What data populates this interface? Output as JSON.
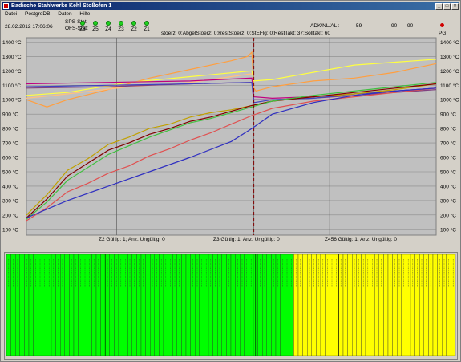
{
  "window": {
    "title": "Badische Stahlwerke Kehl Stoßofen 1"
  },
  "menu": [
    "Datei",
    "PostgreDB",
    "Daten",
    "Hilfe"
  ],
  "info": {
    "datetime": "28.02.2012 17:06:06",
    "sps_label": "SPS-Stat:",
    "ofs_label": "OFS-Stat:",
    "zones": [
      "Z6",
      "Z5",
      "Z4",
      "Z3",
      "Z2",
      "Z1"
    ],
    "status_text": "stoerz:   0;AbgelStoerz:   0;RestStoerz:   0;StEFlg: 0;RestTakt:   37;Solltakt: 60",
    "adk_label": "ADK/NL/AL  :",
    "adk_value": "59",
    "val_a": "90",
    "val_b": "90",
    "pg_label": "PG",
    "led_color": "#1fd11f",
    "pg_color": "#d00000"
  },
  "chart_data": {
    "type": "line",
    "title": "",
    "xlabel": "",
    "ylabel": "",
    "ylim": [
      60,
      1430
    ],
    "yticks": [
      "1400 °C",
      "1300 °C",
      "1200 °C",
      "1100 °C",
      "1000 °C",
      "900 °C",
      "800 °C",
      "700 °C",
      "600 °C",
      "500 °C",
      "400 °C",
      "300 °C",
      "200 °C",
      "100 °C"
    ],
    "yticks_values": [
      1400,
      1300,
      1200,
      1100,
      1000,
      900,
      800,
      700,
      600,
      500,
      400,
      300,
      200,
      100
    ],
    "xlim": [
      0,
      100
    ],
    "marker_x": 55.5,
    "grid_x": [
      22,
      55.5,
      74
    ],
    "series": [
      {
        "color": "#ff9f40",
        "x": [
          0,
          5,
          10,
          20,
          30,
          40,
          50,
          54,
          55,
          55.5,
          56,
          60,
          70,
          80,
          90,
          100
        ],
        "y": [
          1000,
          950,
          1000,
          1070,
          1150,
          1210,
          1270,
          1300,
          1330,
          1080,
          1060,
          1090,
          1130,
          1150,
          1190,
          1250
        ]
      },
      {
        "color": "#ffff40",
        "x": [
          0,
          10,
          25,
          40,
          55,
          55.5,
          60,
          70,
          80,
          90,
          100
        ],
        "y": [
          1030,
          1050,
          1120,
          1160,
          1200,
          1130,
          1140,
          1190,
          1240,
          1260,
          1280
        ]
      },
      {
        "color": "#ffc080",
        "x": [
          0,
          10,
          25,
          40,
          55
        ],
        "y": [
          1010,
          1040,
          1090,
          1120,
          1180
        ]
      },
      {
        "color": "#c00080",
        "x": [
          0,
          20,
          40,
          55,
          55.5,
          60,
          70,
          80,
          90,
          100
        ],
        "y": [
          1110,
          1120,
          1130,
          1150,
          1020,
          1010,
          1020,
          1040,
          1060,
          1080
        ]
      },
      {
        "color": "#804080",
        "x": [
          0,
          20,
          40,
          55,
          55.5,
          60,
          70,
          80,
          90,
          100
        ],
        "y": [
          1080,
          1090,
          1110,
          1120,
          1000,
          1000,
          1010,
          1030,
          1050,
          1070
        ]
      },
      {
        "color": "#4040c0",
        "x": [
          0,
          20,
          40,
          55,
          55.5,
          60,
          70,
          80,
          90,
          100
        ],
        "y": [
          1090,
          1100,
          1110,
          1120,
          980,
          1000,
          1010,
          1040,
          1060,
          1080
        ]
      },
      {
        "color": "#c0a000",
        "x": [
          0,
          5,
          10,
          15,
          20,
          25,
          30,
          35,
          40,
          45,
          50,
          55,
          60,
          70,
          80,
          90,
          100
        ],
        "y": [
          200,
          340,
          510,
          590,
          690,
          740,
          800,
          830,
          880,
          910,
          930,
          960,
          990,
          1020,
          1040,
          1070,
          1110
        ]
      },
      {
        "color": "#800000",
        "x": [
          0,
          5,
          10,
          15,
          20,
          25,
          30,
          35,
          40,
          45,
          50,
          55,
          60,
          70,
          80,
          90,
          100
        ],
        "y": [
          180,
          310,
          470,
          560,
          650,
          700,
          760,
          800,
          850,
          880,
          920,
          960,
          990,
          1020,
          1050,
          1080,
          1110
        ]
      },
      {
        "color": "#40c040",
        "x": [
          0,
          5,
          10,
          15,
          20,
          25,
          30,
          35,
          40,
          45,
          50,
          55,
          60,
          70,
          80,
          90,
          100
        ],
        "y": [
          170,
          290,
          440,
          530,
          620,
          680,
          740,
          790,
          840,
          870,
          910,
          950,
          990,
          1030,
          1060,
          1090,
          1120
        ]
      },
      {
        "color": "#e05050",
        "x": [
          0,
          5,
          10,
          15,
          20,
          25,
          30,
          35,
          40,
          45,
          50,
          55,
          60,
          70,
          80,
          90,
          100
        ],
        "y": [
          160,
          250,
          360,
          420,
          490,
          540,
          610,
          660,
          720,
          770,
          830,
          890,
          940,
          990,
          1020,
          1050,
          1080
        ]
      },
      {
        "color": "#3030c0",
        "x": [
          0,
          10,
          20,
          30,
          40,
          50,
          55,
          60,
          70,
          80,
          90,
          100
        ],
        "y": [
          180,
          300,
          400,
          500,
          600,
          710,
          800,
          900,
          980,
          1030,
          1060,
          1080
        ]
      }
    ]
  },
  "status_row": {
    "z2": "Z2 Gültig:  1; Anz. Ungültig:  0",
    "z3": "Z3 Gültig:  1; Anz. Ungültig:  0",
    "z456": "Z456 Gültig:  1; Anz. Ungültig:  0"
  },
  "bottom_panel": {
    "green_color": "#00ff00",
    "yellow_color": "#ffff00",
    "green_bars": 64,
    "yellow_bars": 36
  }
}
